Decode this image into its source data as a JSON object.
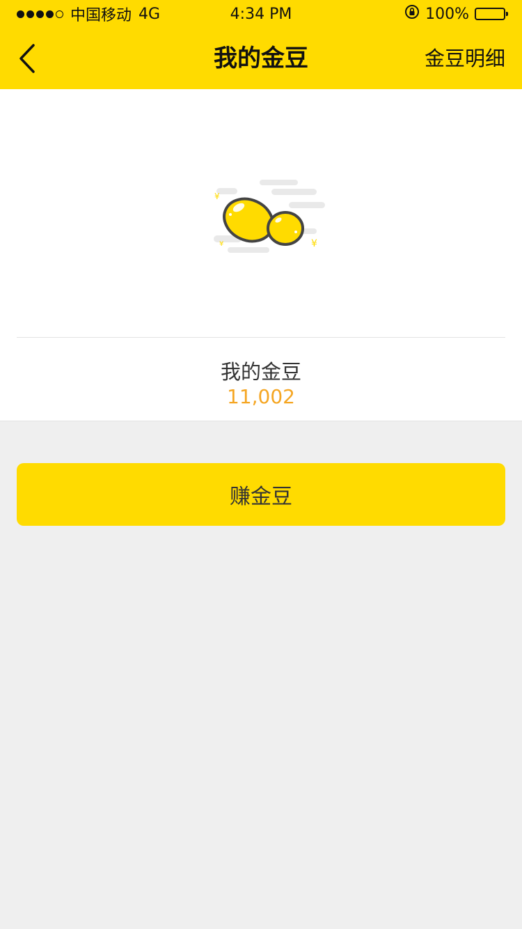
{
  "status_bar": {
    "carrier": "中国移动",
    "network": "4G",
    "time": "4:34 PM",
    "battery": "100%"
  },
  "nav": {
    "title": "我的金豆",
    "right_action": "金豆明细",
    "back_icon": "chevron-left-icon"
  },
  "card": {
    "illustration_icon": "gold-beans-icon",
    "label": "我的金豆",
    "value": "11,002"
  },
  "earn_button": {
    "label": "赚金豆"
  },
  "colors": {
    "brand_yellow": "#FFDB00",
    "value_orange": "#F5A623",
    "background": "#efefef"
  }
}
